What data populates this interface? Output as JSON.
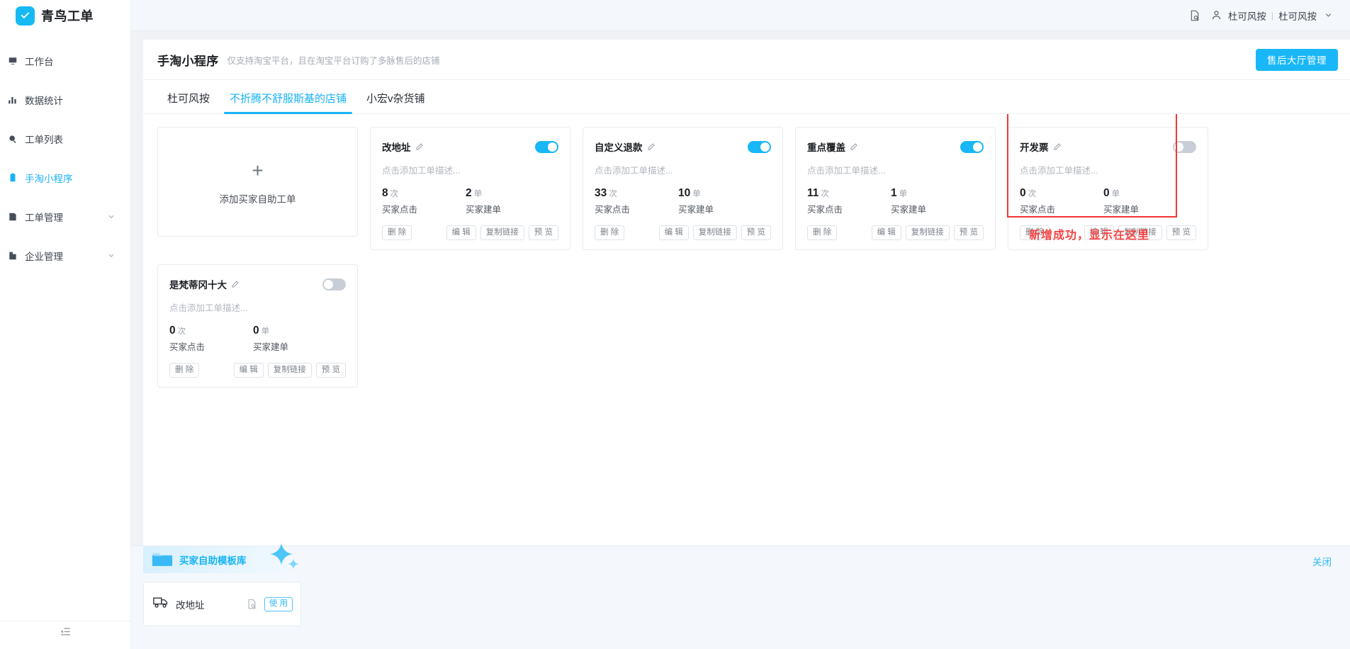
{
  "brand": {
    "name": "青鸟工单",
    "logo_icon": "check-badge-icon",
    "accent": "#17b9f3"
  },
  "sidebar": {
    "items": [
      {
        "label": "工作台",
        "icon": "monitor-icon",
        "active": false,
        "expandable": false
      },
      {
        "label": "数据统计",
        "icon": "bar-chart-icon",
        "active": false,
        "expandable": false
      },
      {
        "label": "工单列表",
        "icon": "search-icon",
        "active": false,
        "expandable": false
      },
      {
        "label": "手淘小程序",
        "icon": "clipboard-icon",
        "active": true,
        "expandable": false
      },
      {
        "label": "工单管理",
        "icon": "file-icon",
        "active": false,
        "expandable": true
      },
      {
        "label": "企业管理",
        "icon": "building-icon",
        "active": false,
        "expandable": true
      }
    ],
    "collapse_icon": "menu-fold-icon"
  },
  "topbar": {
    "doc_icon": "document-search-icon",
    "user_icon": "user-icon",
    "user_name": "杜可风按",
    "separator": "|",
    "account_name": "杜可风按",
    "chevron_icon": "chevron-down-icon"
  },
  "page": {
    "title": "手淘小程序",
    "subtitle": "仅支持淘宝平台，且在淘宝平台订购了多脉售后的店铺",
    "action_button": "售后大厅管理"
  },
  "tabs": [
    {
      "label": "杜可风按",
      "active": false
    },
    {
      "label": "不折腾不舒服斯基的店铺",
      "active": true
    },
    {
      "label": "小宏v杂货铺",
      "active": false
    }
  ],
  "add_card": {
    "plus_icon": "plus-icon",
    "label": "添加买家自助工单"
  },
  "card_common": {
    "description_placeholder": "点击添加工单描述...",
    "clicks_label": "买家点击",
    "orders_label": "买家建单",
    "clicks_unit": "次",
    "orders_unit": "单",
    "edit_icon": "pencil-icon",
    "actions": {
      "delete": "删 除",
      "edit": "编 辑",
      "copy_link": "复制链接",
      "preview": "预 览"
    }
  },
  "cards": [
    {
      "title": "改地址",
      "enabled": true,
      "clicks": "8",
      "orders": "2",
      "highlighted": false
    },
    {
      "title": "自定义退款",
      "enabled": true,
      "clicks": "33",
      "orders": "10",
      "highlighted": false
    },
    {
      "title": "重点覆盖",
      "enabled": true,
      "clicks": "11",
      "orders": "1",
      "highlighted": false
    },
    {
      "title": "开发票",
      "enabled": false,
      "clicks": "0",
      "orders": "0",
      "highlighted": true
    },
    {
      "title": "是梵蒂冈十大",
      "enabled": false,
      "clicks": "0",
      "orders": "0",
      "highlighted": false
    }
  ],
  "annotation": {
    "text": "新增成功，显示在这里",
    "color": "#f84343"
  },
  "template_panel": {
    "banner_title": "买家自助模板库",
    "folder_icon": "folder-icon",
    "sparkle_icon": "sparkle-icon",
    "close_label": "关闭",
    "templates": [
      {
        "name": "改地址",
        "icon": "truck-icon",
        "preview_icon": "preview-icon",
        "use_label": "使 用"
      }
    ]
  }
}
